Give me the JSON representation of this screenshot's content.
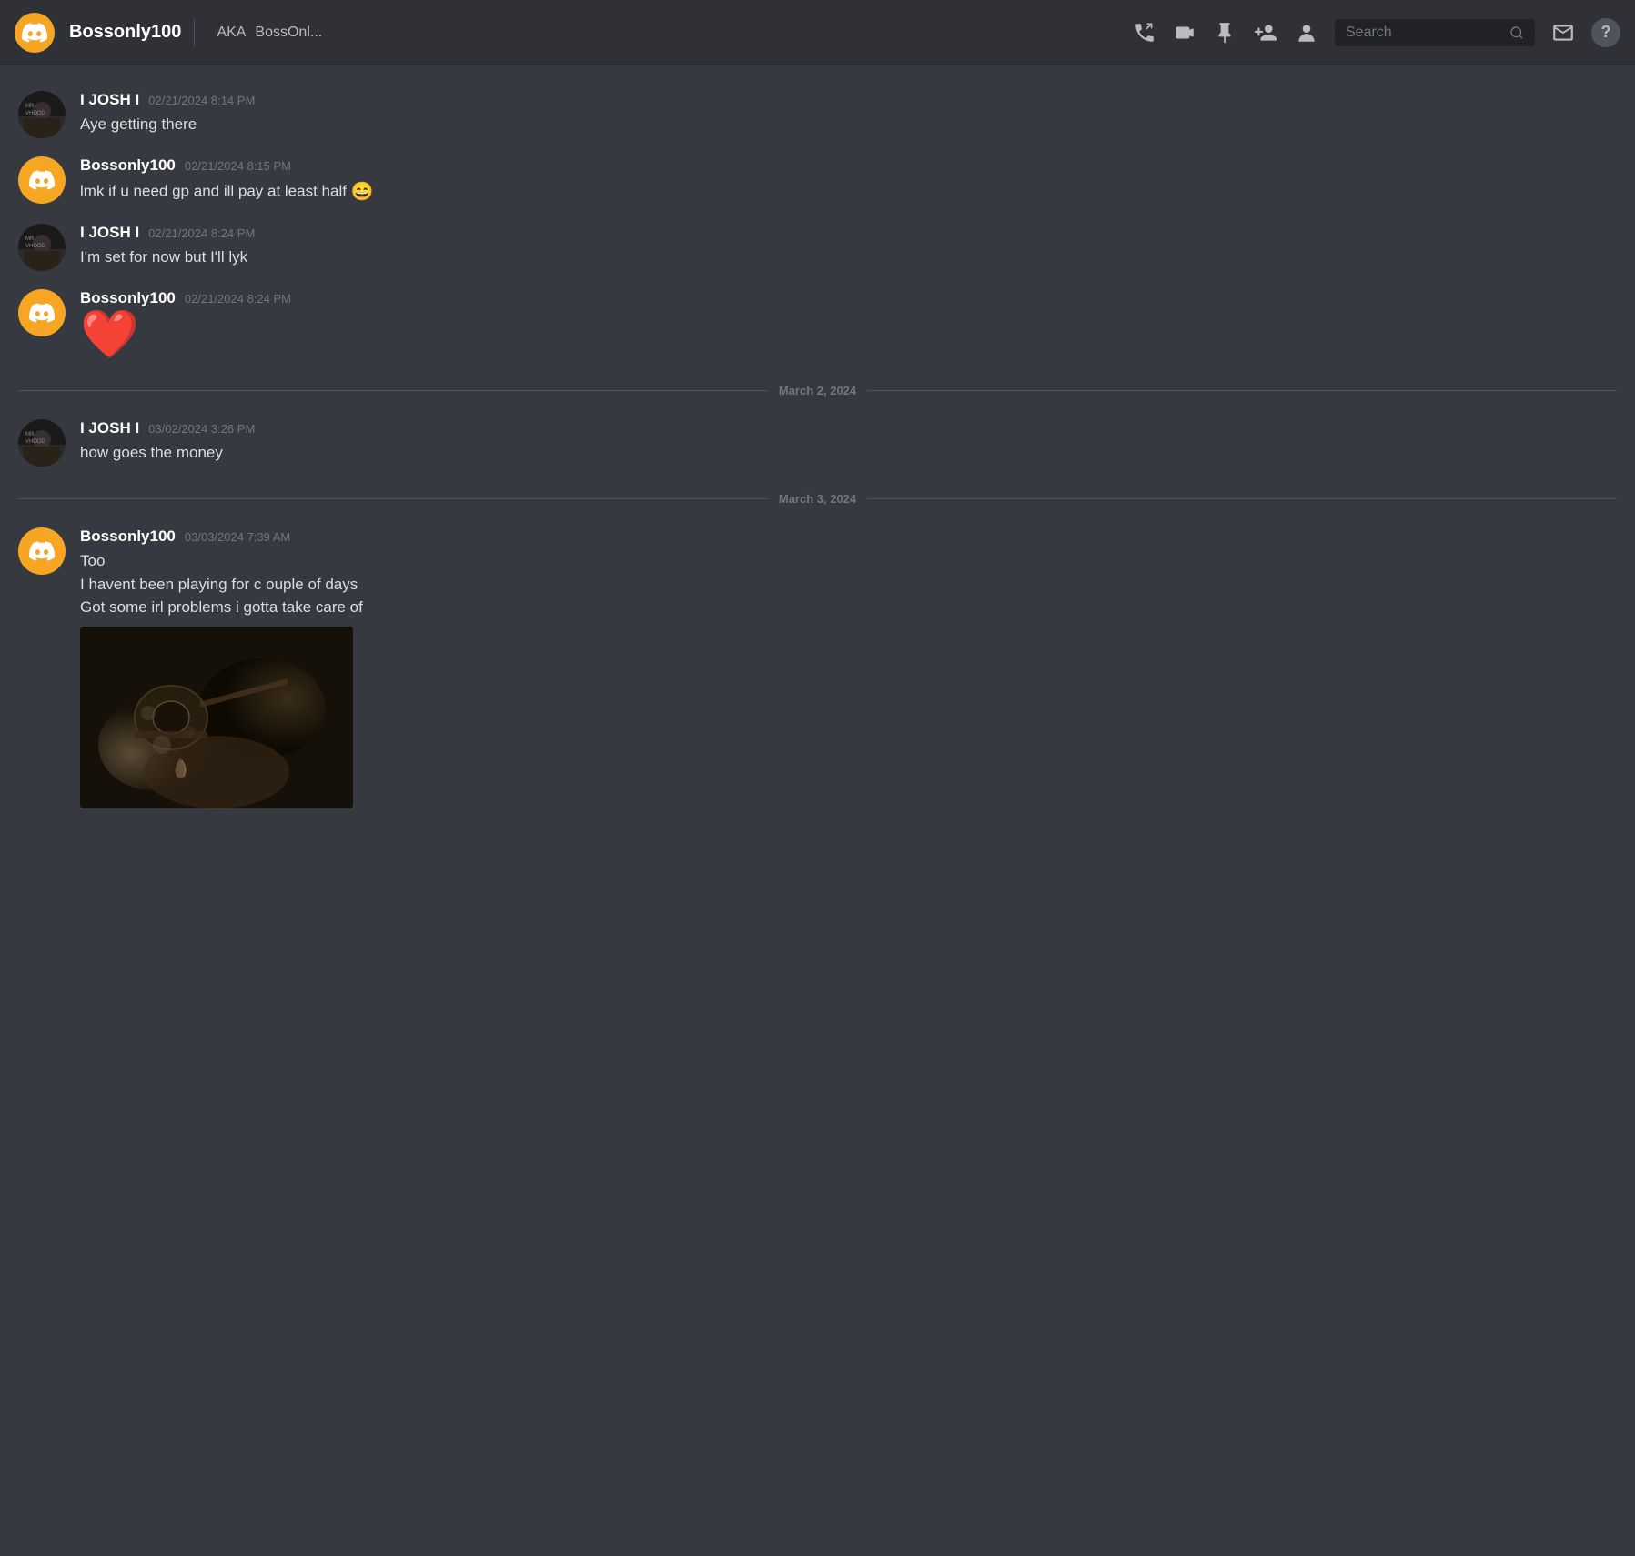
{
  "header": {
    "username": "Bossonly100",
    "aka_label": "AKA",
    "aka_name": "BossOnl...",
    "search_placeholder": "Search",
    "icons": {
      "phone": "📞",
      "video": "📷",
      "pin": "📌",
      "add_member": "👥",
      "profile": "👤",
      "inbox": "💬",
      "help": "?"
    }
  },
  "messages": [
    {
      "id": "msg1",
      "author": "I JOSH I",
      "author_type": "josh",
      "timestamp": "02/21/2024 8:14 PM",
      "text": "Aye getting there",
      "has_emoji": false,
      "has_heart": false,
      "has_image": false
    },
    {
      "id": "msg2",
      "author": "Bossonly100",
      "author_type": "boss",
      "timestamp": "02/21/2024 8:15 PM",
      "text": "lmk if u need gp and ill pay at least half 😄",
      "has_emoji": true,
      "emoji": "😄",
      "has_heart": false,
      "has_image": false
    },
    {
      "id": "msg3",
      "author": "I JOSH I",
      "author_type": "josh",
      "timestamp": "02/21/2024 8:24 PM",
      "text": "I'm set for now but I'll lyk",
      "has_emoji": false,
      "has_heart": false,
      "has_image": false
    },
    {
      "id": "msg4",
      "author": "Bossonly100",
      "author_type": "boss",
      "timestamp": "02/21/2024 8:24 PM",
      "text": "",
      "has_emoji": false,
      "has_heart": true,
      "has_image": false
    }
  ],
  "date_separators": [
    {
      "id": "sep1",
      "label": "March 2, 2024"
    },
    {
      "id": "sep2",
      "label": "March 3, 2024"
    }
  ],
  "messages_after_sep1": [
    {
      "id": "msg5",
      "author": "I JOSH I",
      "author_type": "josh",
      "timestamp": "03/02/2024 3:26 PM",
      "text": "how goes the money",
      "has_emoji": false,
      "has_heart": false,
      "has_image": false
    }
  ],
  "messages_after_sep2": [
    {
      "id": "msg6",
      "author": "Bossonly100",
      "author_type": "boss",
      "timestamp": "03/03/2024 7:39 AM",
      "text_lines": [
        "Too",
        "I havent been playing for c ouple of days",
        "Got some irl problems i gotta take care of"
      ],
      "has_emoji": false,
      "has_heart": false,
      "has_image": true
    }
  ]
}
